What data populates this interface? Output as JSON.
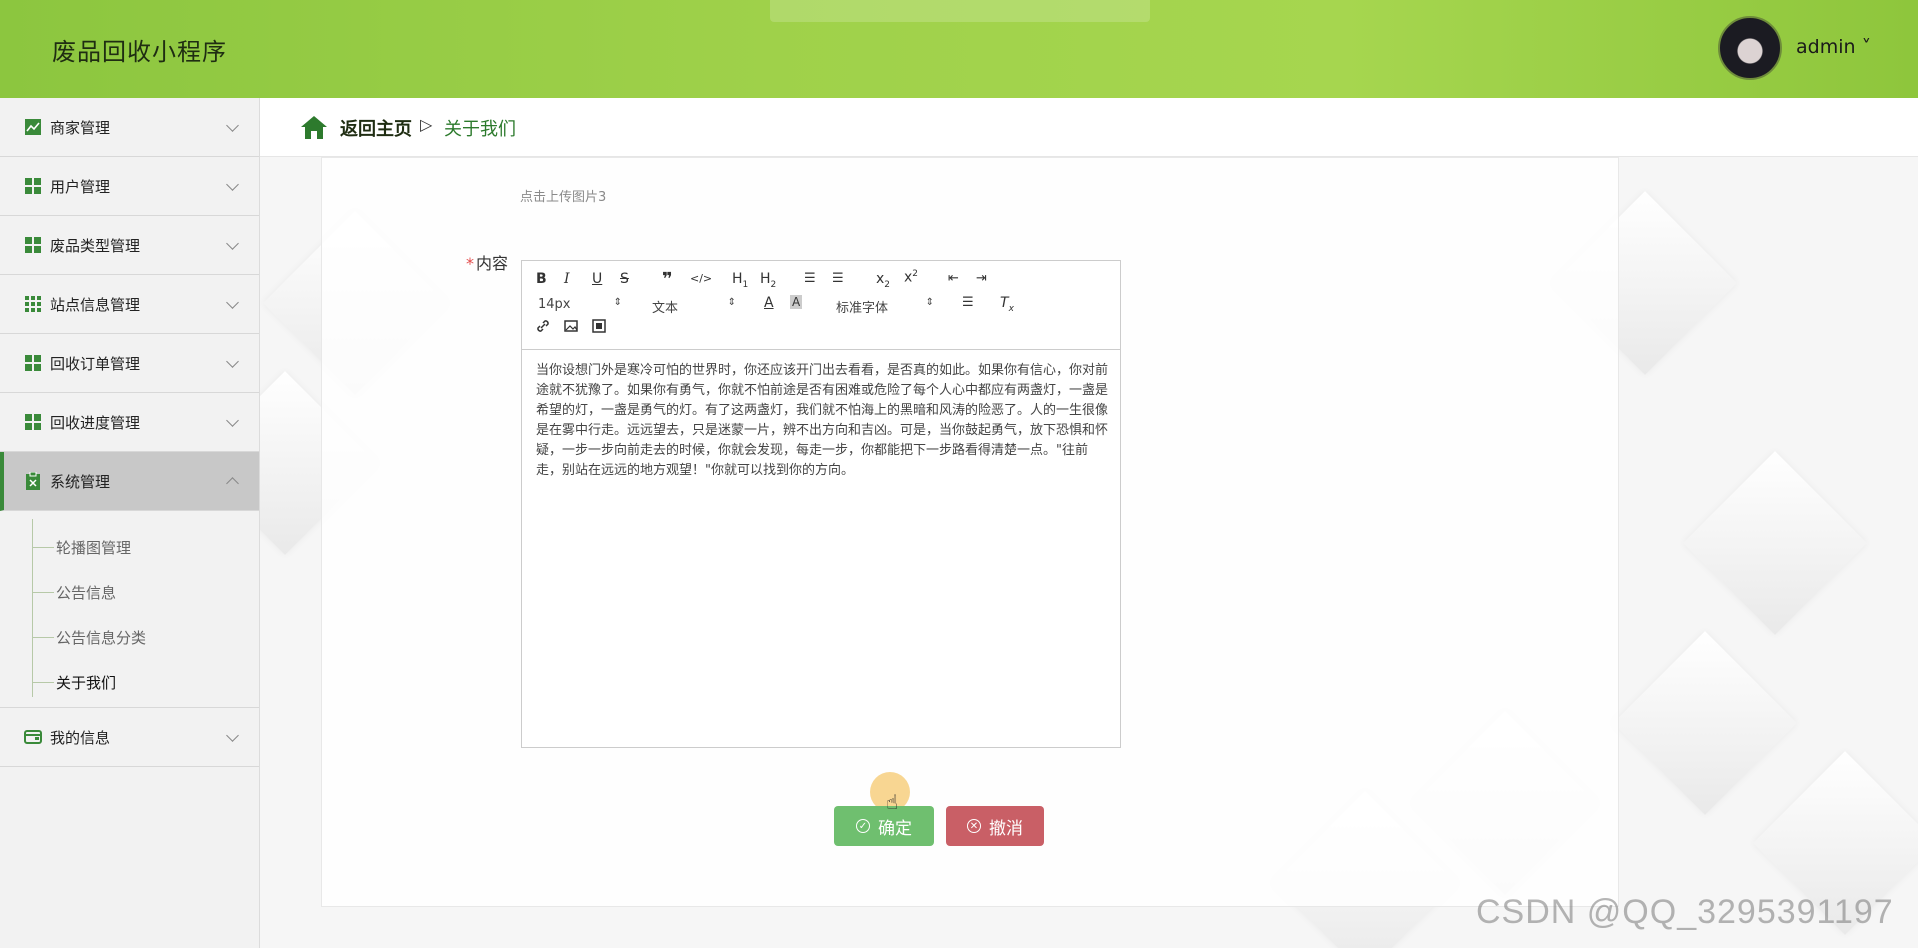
{
  "header": {
    "app_title": "废品回收小程序",
    "user_name": "admin ˅"
  },
  "sidebar": {
    "items": [
      {
        "label": "商家管理",
        "icon": "chart-icon"
      },
      {
        "label": "用户管理",
        "icon": "grid-icon"
      },
      {
        "label": "废品类型管理",
        "icon": "grid-icon"
      },
      {
        "label": "站点信息管理",
        "icon": "grid9-icon"
      },
      {
        "label": "回收订单管理",
        "icon": "grid-icon"
      },
      {
        "label": "回收进度管理",
        "icon": "grid-icon"
      },
      {
        "label": "系统管理",
        "icon": "clipboard-icon"
      },
      {
        "label": "我的信息",
        "icon": "wallet-icon"
      }
    ],
    "submenu": [
      {
        "label": "轮播图管理"
      },
      {
        "label": "公告信息"
      },
      {
        "label": "公告信息分类"
      },
      {
        "label": "关于我们"
      }
    ]
  },
  "breadcrumb": {
    "home": "返回主页",
    "separator": "▷",
    "current": "关于我们"
  },
  "form": {
    "upload_tip": "点击上传图片3",
    "content_label": "内容",
    "required_mark": "*",
    "editor": {
      "font_size": "14px",
      "block_type": "文本",
      "font_family": "标准字体",
      "text": "当你设想门外是寒冷可怕的世界时，你还应该开门出去看看，是否真的如此。如果你有信心，你对前途就不犹豫了。如果你有勇气，你就不怕前途是否有困难或危险了每个人心中都应有两盏灯，一盏是希望的灯，一盏是勇气的灯。有了这两盏灯，我们就不怕海上的黑暗和风涛的险恶了。人的一生很像是在雾中行走。远远望去，只是迷蒙一片，辨不出方向和吉凶。可是，当你鼓起勇气，放下恐惧和怀疑，一步一步向前走去的时候，你就会发现，每走一步，你都能把下一步路看得清楚一点。\"往前走，别站在远远的地方观望！\"你就可以找到你的方向。"
    },
    "confirm_label": "确定",
    "cancel_label": "撤消"
  },
  "watermark": "CSDN @QQ_3295391197",
  "colors": {
    "header_green": "#9fd14a",
    "active_border": "#3a8a3a",
    "confirm": "#6fbf6f",
    "cancel": "#c95f66"
  }
}
